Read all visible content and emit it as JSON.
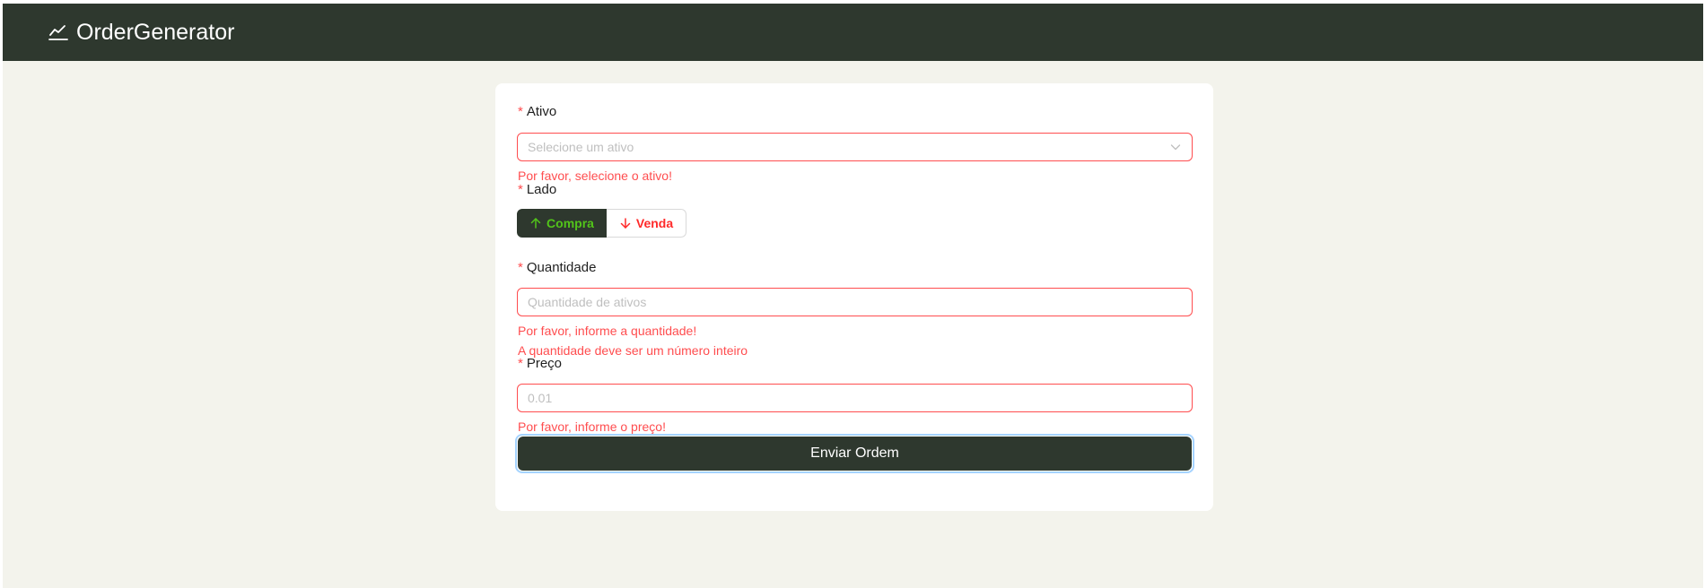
{
  "app": {
    "title": "OrderGenerator",
    "icon": "line-chart-icon"
  },
  "colors": {
    "navbar": "#2e382e",
    "page_bg": "#f3f3ec",
    "error": "#ff4d4f",
    "buy": "#52c41a",
    "sell": "#ff2a2a",
    "focus_ring": "#a5d3ff"
  },
  "form": {
    "asset": {
      "label": "Ativo",
      "required_mark": "*",
      "placeholder": "Selecione um ativo",
      "error": "Por favor, selecione o ativo!"
    },
    "side": {
      "label": "Lado",
      "required_mark": "*",
      "selected": "Compra",
      "options": [
        {
          "label": "Compra",
          "icon": "arrow-up-icon"
        },
        {
          "label": "Venda",
          "icon": "arrow-down-icon"
        }
      ]
    },
    "quantity": {
      "label": "Quantidade",
      "required_mark": "*",
      "placeholder": "Quantidade de ativos",
      "errors": [
        "Por favor, informe a quantidade!",
        "A quantidade deve ser um número inteiro"
      ]
    },
    "price": {
      "label": "Preço",
      "required_mark": "*",
      "placeholder": "0.01",
      "error": "Por favor, informe o preço!"
    },
    "submit_label": "Enviar Ordem"
  }
}
